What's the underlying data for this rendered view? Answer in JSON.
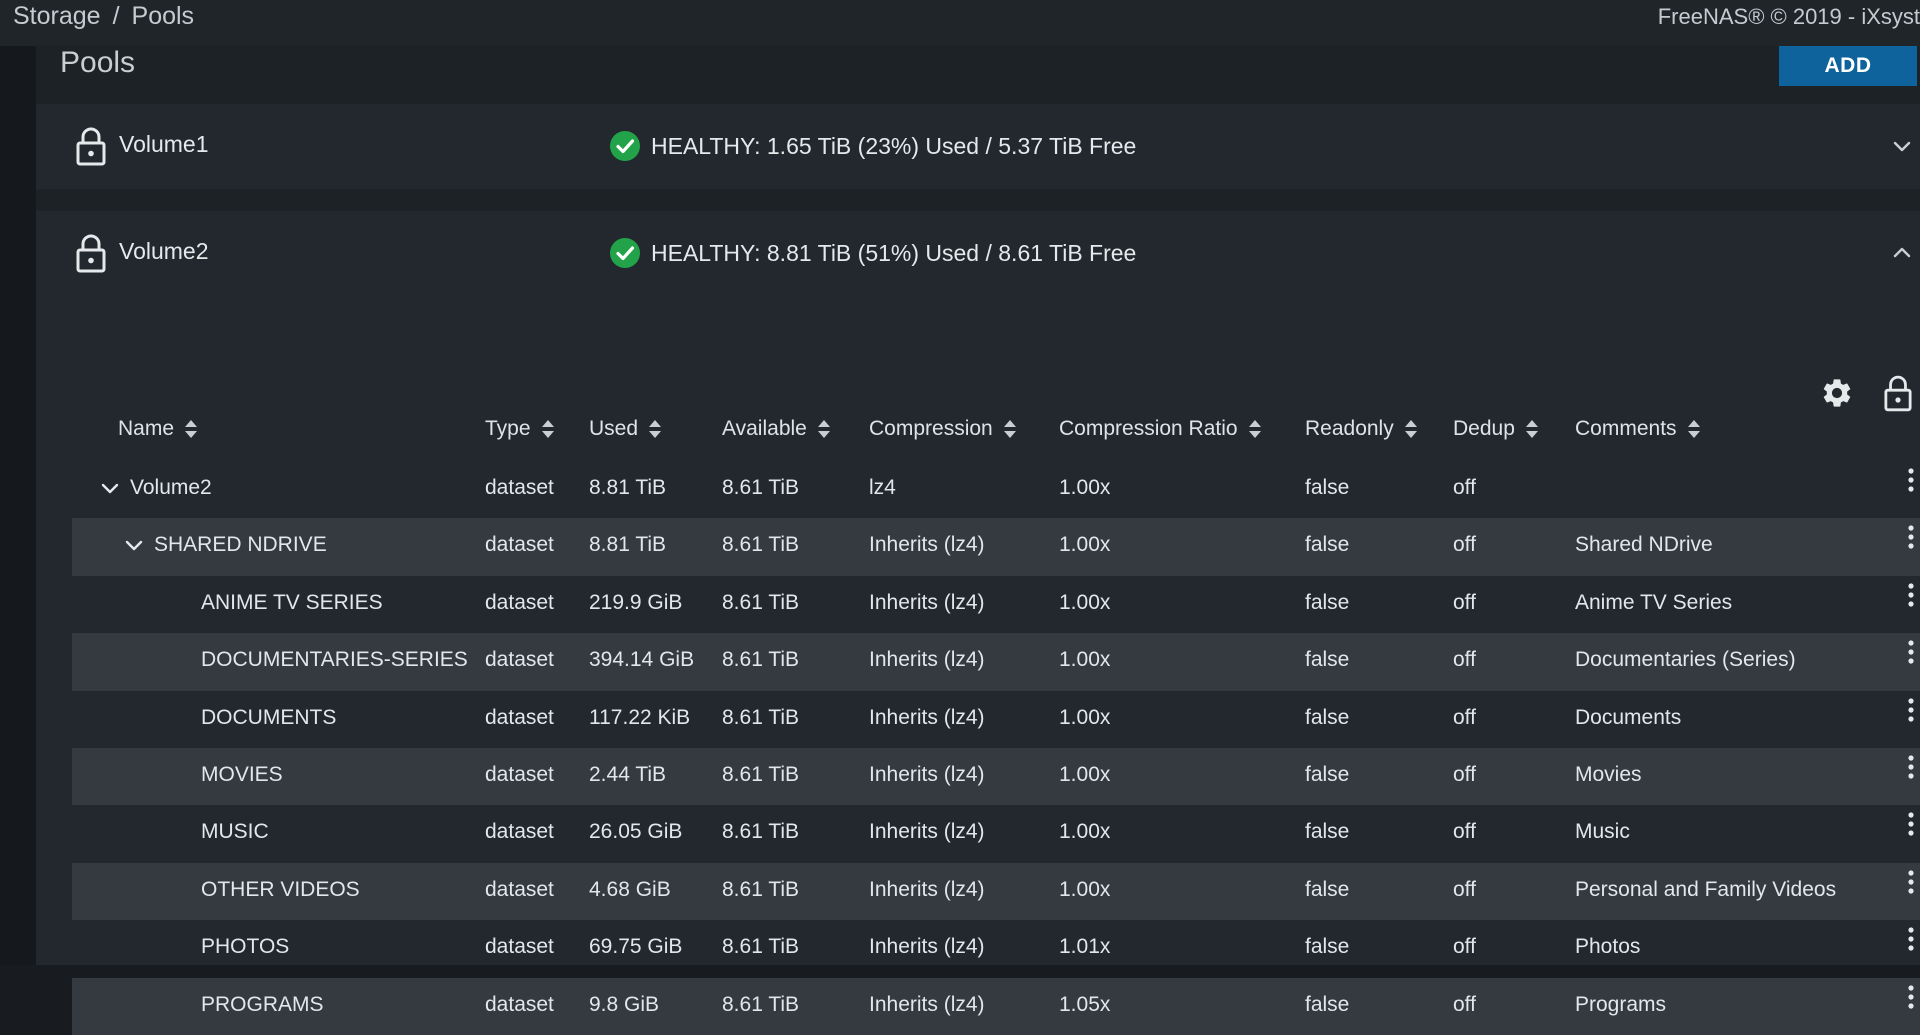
{
  "topbar": {
    "breadcrumb": [
      "Storage",
      "Pools"
    ],
    "breadcrumb_separator": "/",
    "copyright": "FreeNAS® © 2019 - iXsyst"
  },
  "page": {
    "title": "Pools",
    "add_label": "ADD"
  },
  "pools": [
    {
      "name": "Volume1",
      "status": "HEALTHY: 1.65 TiB (23%) Used / 5.37 TiB Free",
      "expanded": false,
      "toggle_icon": "chevron-down-icon"
    },
    {
      "name": "Volume2",
      "status": "HEALTHY: 8.81 TiB (51%) Used / 8.61 TiB Free",
      "expanded": true,
      "toggle_icon": "chevron-up-icon"
    }
  ],
  "colors": {
    "healthy": "#22a34a",
    "accent": "#0e639c"
  },
  "table": {
    "columns": [
      "Name",
      "Type",
      "Used",
      "Available",
      "Compression",
      "Compression Ratio",
      "Readonly",
      "Dedup",
      "Comments"
    ],
    "rows": [
      {
        "name": "Volume2",
        "level": 0,
        "expandable": true,
        "type": "dataset",
        "used": "8.81 TiB",
        "available": "8.61 TiB",
        "compression": "lz4",
        "ratio": "1.00x",
        "readonly": "false",
        "dedup": "off",
        "comments": ""
      },
      {
        "name": "SHARED NDRIVE",
        "level": 1,
        "expandable": true,
        "type": "dataset",
        "used": "8.81 TiB",
        "available": "8.61 TiB",
        "compression": "Inherits (lz4)",
        "ratio": "1.00x",
        "readonly": "false",
        "dedup": "off",
        "comments": "Shared NDrive"
      },
      {
        "name": "ANIME TV SERIES",
        "level": 2,
        "expandable": false,
        "type": "dataset",
        "used": "219.9 GiB",
        "available": "8.61 TiB",
        "compression": "Inherits (lz4)",
        "ratio": "1.00x",
        "readonly": "false",
        "dedup": "off",
        "comments": "Anime TV Series"
      },
      {
        "name": "DOCUMENTARIES-SERIES",
        "level": 2,
        "expandable": false,
        "type": "dataset",
        "used": "394.14 GiB",
        "available": "8.61 TiB",
        "compression": "Inherits (lz4)",
        "ratio": "1.00x",
        "readonly": "false",
        "dedup": "off",
        "comments": "Documentaries (Series)"
      },
      {
        "name": "DOCUMENTS",
        "level": 2,
        "expandable": false,
        "type": "dataset",
        "used": "117.22 KiB",
        "available": "8.61 TiB",
        "compression": "Inherits (lz4)",
        "ratio": "1.00x",
        "readonly": "false",
        "dedup": "off",
        "comments": "Documents"
      },
      {
        "name": "MOVIES",
        "level": 2,
        "expandable": false,
        "type": "dataset",
        "used": "2.44 TiB",
        "available": "8.61 TiB",
        "compression": "Inherits (lz4)",
        "ratio": "1.00x",
        "readonly": "false",
        "dedup": "off",
        "comments": "Movies"
      },
      {
        "name": "MUSIC",
        "level": 2,
        "expandable": false,
        "type": "dataset",
        "used": "26.05 GiB",
        "available": "8.61 TiB",
        "compression": "Inherits (lz4)",
        "ratio": "1.00x",
        "readonly": "false",
        "dedup": "off",
        "comments": "Music"
      },
      {
        "name": "OTHER VIDEOS",
        "level": 2,
        "expandable": false,
        "type": "dataset",
        "used": "4.68 GiB",
        "available": "8.61 TiB",
        "compression": "Inherits (lz4)",
        "ratio": "1.00x",
        "readonly": "false",
        "dedup": "off",
        "comments": "Personal and Family Videos"
      },
      {
        "name": "PHOTOS",
        "level": 2,
        "expandable": false,
        "type": "dataset",
        "used": "69.75 GiB",
        "available": "8.61 TiB",
        "compression": "Inherits (lz4)",
        "ratio": "1.01x",
        "readonly": "false",
        "dedup": "off",
        "comments": "Photos"
      },
      {
        "name": "PROGRAMS",
        "level": 2,
        "expandable": false,
        "type": "dataset",
        "used": "9.8 GiB",
        "available": "8.61 TiB",
        "compression": "Inherits (lz4)",
        "ratio": "1.05x",
        "readonly": "false",
        "dedup": "off",
        "comments": "Programs"
      }
    ]
  }
}
